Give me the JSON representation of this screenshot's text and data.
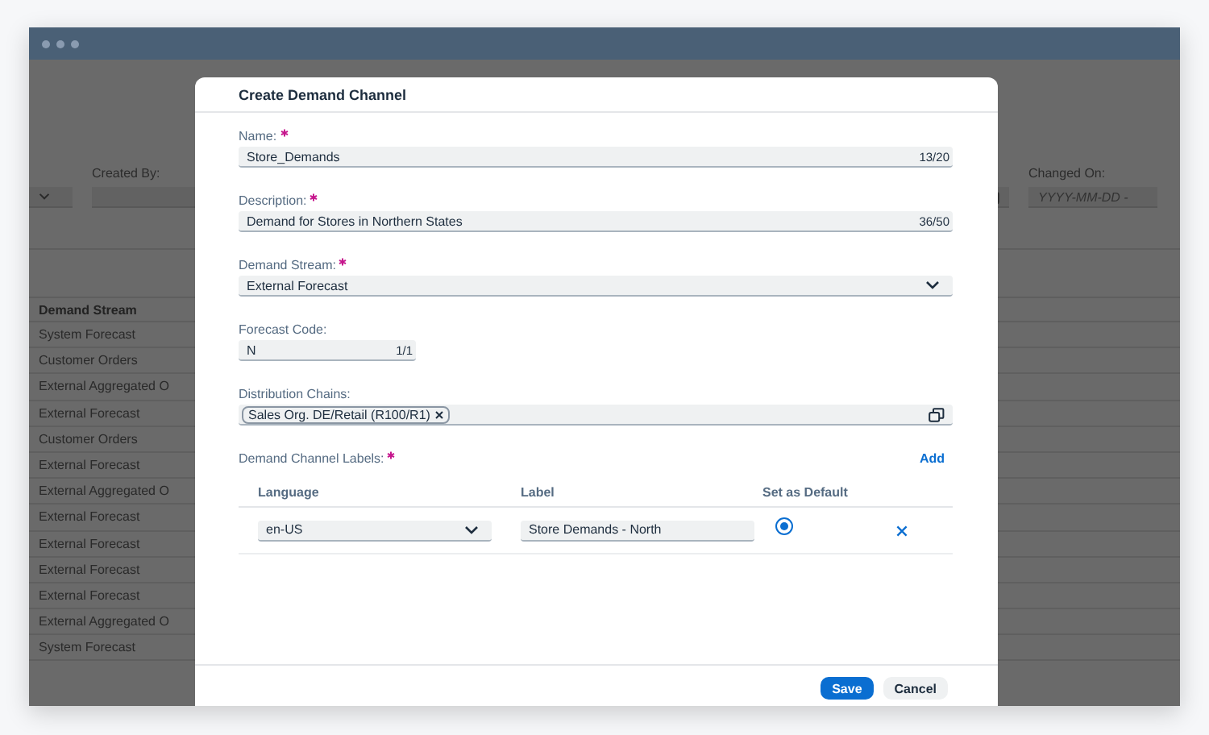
{
  "background": {
    "filters": [
      {
        "kind": "select"
      },
      {
        "kind": "text",
        "label": "Created By:"
      },
      {
        "kind": "date"
      },
      {
        "kind": "date_range",
        "label": "Changed On:",
        "placeholder": "YYYY-MM-DD -"
      }
    ],
    "table": {
      "column": "Demand Stream",
      "rows": [
        "System Forecast",
        "Customer Orders",
        "External Aggregated O",
        "External Forecast",
        "Customer Orders",
        "External Forecast",
        "External Aggregated O",
        "External Forecast",
        "External Forecast",
        "External Forecast",
        "External Forecast",
        "External Aggregated O",
        "System Forecast"
      ]
    }
  },
  "dialog": {
    "title": "Create Demand Channel",
    "fields": [
      {
        "kind": "text",
        "label": "Name:",
        "required": true,
        "value": "Store_Demands",
        "counter": "13/20"
      },
      {
        "kind": "text",
        "label": "Description:",
        "required": true,
        "value": "Demand for Stores in Northern States",
        "counter": "36/50"
      },
      {
        "kind": "select",
        "label": "Demand Stream:",
        "required": true,
        "value": "External Forecast"
      },
      {
        "kind": "short",
        "label": "Forecast Code:",
        "required": false,
        "value": "N",
        "counter": "1/1"
      },
      {
        "kind": "tokens",
        "label": "Distribution Chains:",
        "required": false,
        "tokens": [
          "Sales Org. DE/Retail (R100/R1)"
        ]
      }
    ],
    "labels_table": {
      "label": "Demand Channel Labels:",
      "required": true,
      "add_action": "Add",
      "columns": [
        "Language",
        "Label",
        "Set as Default"
      ],
      "rows": [
        {
          "language": "en-US",
          "label": "Store Demands - North",
          "default": true
        }
      ]
    },
    "buttons": [
      {
        "kind": "primary",
        "label": "Save"
      },
      {
        "kind": "secondary",
        "label": "Cancel"
      }
    ]
  }
}
